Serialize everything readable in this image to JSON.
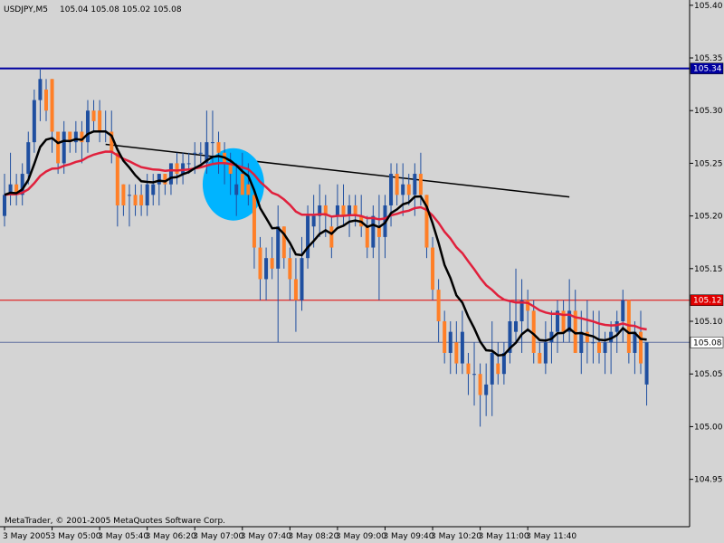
{
  "chart_data": {
    "type": "candlestick",
    "header": {
      "symbol_timeframe": "USDJPY,M5",
      "ohlc": "105.04 105.08 105.02 105.08"
    },
    "copyright": "MetaTrader, © 2001-2005 MetaQuotes Software Corp.",
    "y_axis": {
      "range": [
        104.905,
        105.405
      ],
      "ticks": [
        105.4,
        105.35,
        105.3,
        105.25,
        105.2,
        105.15,
        105.1,
        105.05,
        105.0,
        104.95
      ],
      "tick_labels": [
        "105.40",
        "105.35",
        "105.30",
        "105.25",
        "105.20",
        "105.15",
        "105.10",
        "105.05",
        "105.00",
        "104.95"
      ]
    },
    "x_axis": {
      "ticks": [
        {
          "bar": 0,
          "label": "3 May 2005"
        },
        {
          "bar": 8,
          "label": "3 May 05:00"
        },
        {
          "bar": 16,
          "label": "3 May 05:40"
        },
        {
          "bar": 24,
          "label": "3 May 06:20"
        },
        {
          "bar": 32,
          "label": "3 May 07:00"
        },
        {
          "bar": 40,
          "label": "3 May 07:40"
        },
        {
          "bar": 48,
          "label": "3 May 08:20"
        },
        {
          "bar": 56,
          "label": "3 May 09:00"
        },
        {
          "bar": 64,
          "label": "3 May 09:40"
        },
        {
          "bar": 72,
          "label": "3 May 10:20"
        },
        {
          "bar": 80,
          "label": "3 May 11:00"
        },
        {
          "bar": 88,
          "label": "3 May 11:40"
        }
      ]
    },
    "horizontal_lines": [
      {
        "price": 105.34,
        "label": "105.34",
        "color": "#0000a0",
        "width": 2,
        "label_bg": "#0000a0",
        "label_fg": "#ffffff"
      },
      {
        "price": 105.12,
        "label": "105.12",
        "color": "#e00000",
        "width": 1,
        "label_bg": "#e00000",
        "label_fg": "#ffffff"
      },
      {
        "price": 105.08,
        "label": "105.08",
        "color": "#6070a0",
        "width": 1,
        "label_bg": "#ffffff",
        "label_fg": "#000000"
      }
    ],
    "trendline": {
      "from": {
        "bar": 17,
        "price": 105.268
      },
      "to": {
        "bar": 95,
        "price": 105.218
      },
      "color": "#000000"
    },
    "highlight_circle": {
      "bar": 38.5,
      "price": 105.23,
      "color": "#00b4ff"
    },
    "bull_color": "#1f4fa0",
    "bear_color": "#ff7f27",
    "ma_fast_color": "#000000",
    "ma_slow_color": "#e0203c",
    "candles": [
      [
        105.2,
        105.24,
        105.19,
        105.22
      ],
      [
        105.22,
        105.26,
        105.21,
        105.23
      ],
      [
        105.23,
        105.24,
        105.21,
        105.22
      ],
      [
        105.22,
        105.25,
        105.21,
        105.24
      ],
      [
        105.24,
        105.28,
        105.23,
        105.27
      ],
      [
        105.27,
        105.32,
        105.26,
        105.31
      ],
      [
        105.31,
        105.34,
        105.29,
        105.33
      ],
      [
        105.32,
        105.33,
        105.29,
        105.3
      ],
      [
        105.33,
        105.33,
        105.26,
        105.28
      ],
      [
        105.28,
        105.28,
        105.24,
        105.25
      ],
      [
        105.25,
        105.29,
        105.24,
        105.28
      ],
      [
        105.28,
        105.28,
        105.26,
        105.27
      ],
      [
        105.27,
        105.29,
        105.26,
        105.28
      ],
      [
        105.28,
        105.29,
        105.25,
        105.27
      ],
      [
        105.27,
        105.31,
        105.26,
        105.3
      ],
      [
        105.3,
        105.31,
        105.28,
        105.29
      ],
      [
        105.3,
        105.31,
        105.27,
        105.28
      ],
      [
        105.28,
        105.3,
        105.27,
        105.28
      ],
      [
        105.28,
        105.3,
        105.25,
        105.26
      ],
      [
        105.26,
        105.26,
        105.19,
        105.21
      ],
      [
        105.23,
        105.23,
        105.2,
        105.21
      ],
      [
        105.22,
        105.23,
        105.19,
        105.22
      ],
      [
        105.22,
        105.23,
        105.2,
        105.21
      ],
      [
        105.22,
        105.23,
        105.2,
        105.21
      ],
      [
        105.21,
        105.24,
        105.2,
        105.23
      ],
      [
        105.22,
        105.24,
        105.21,
        105.23
      ],
      [
        105.23,
        105.24,
        105.21,
        105.24
      ],
      [
        105.24,
        105.24,
        105.22,
        105.23
      ],
      [
        105.23,
        105.25,
        105.22,
        105.25
      ],
      [
        105.25,
        105.26,
        105.23,
        105.24
      ],
      [
        105.24,
        105.26,
        105.23,
        105.25
      ],
      [
        105.25,
        105.26,
        105.24,
        105.25
      ],
      [
        105.26,
        105.27,
        105.24,
        105.26
      ],
      [
        105.26,
        105.27,
        105.25,
        105.26
      ],
      [
        105.25,
        105.3,
        105.24,
        105.27
      ],
      [
        105.27,
        105.3,
        105.25,
        105.27
      ],
      [
        105.27,
        105.28,
        105.24,
        105.26
      ],
      [
        105.26,
        105.27,
        105.23,
        105.25
      ],
      [
        105.25,
        105.26,
        105.22,
        105.24
      ],
      [
        105.22,
        105.25,
        105.2,
        105.23
      ],
      [
        105.24,
        105.26,
        105.22,
        105.22
      ],
      [
        105.23,
        105.25,
        105.21,
        105.22
      ],
      [
        105.22,
        105.22,
        105.15,
        105.17
      ],
      [
        105.17,
        105.18,
        105.12,
        105.14
      ],
      [
        105.14,
        105.17,
        105.12,
        105.16
      ],
      [
        105.16,
        105.18,
        105.14,
        105.15
      ],
      [
        105.15,
        105.21,
        105.08,
        105.19
      ],
      [
        105.19,
        105.19,
        105.15,
        105.16
      ],
      [
        105.16,
        105.17,
        105.12,
        105.14
      ],
      [
        105.14,
        105.16,
        105.09,
        105.12
      ],
      [
        105.12,
        105.18,
        105.11,
        105.16
      ],
      [
        105.16,
        105.21,
        105.15,
        105.2
      ],
      [
        105.19,
        105.22,
        105.17,
        105.2
      ],
      [
        105.2,
        105.23,
        105.18,
        105.21
      ],
      [
        105.21,
        105.22,
        105.18,
        105.2
      ],
      [
        105.19,
        105.2,
        105.16,
        105.17
      ],
      [
        105.2,
        105.23,
        105.19,
        105.21
      ],
      [
        105.21,
        105.23,
        105.19,
        105.2
      ],
      [
        105.2,
        105.22,
        105.18,
        105.21
      ],
      [
        105.21,
        105.22,
        105.19,
        105.2
      ],
      [
        105.2,
        105.22,
        105.18,
        105.19
      ],
      [
        105.19,
        105.2,
        105.16,
        105.17
      ],
      [
        105.17,
        105.21,
        105.16,
        105.2
      ],
      [
        105.19,
        105.22,
        105.12,
        105.18
      ],
      [
        105.18,
        105.22,
        105.16,
        105.21
      ],
      [
        105.21,
        105.25,
        105.19,
        105.24
      ],
      [
        105.24,
        105.25,
        105.21,
        105.22
      ],
      [
        105.22,
        105.25,
        105.2,
        105.23
      ],
      [
        105.23,
        105.24,
        105.21,
        105.22
      ],
      [
        105.22,
        105.25,
        105.2,
        105.24
      ],
      [
        105.24,
        105.26,
        105.21,
        105.22
      ],
      [
        105.22,
        105.22,
        105.16,
        105.17
      ],
      [
        105.17,
        105.18,
        105.12,
        105.13
      ],
      [
        105.13,
        105.14,
        105.08,
        105.1
      ],
      [
        105.1,
        105.11,
        105.06,
        105.07
      ],
      [
        105.07,
        105.1,
        105.05,
        105.09
      ],
      [
        105.08,
        105.1,
        105.05,
        105.06
      ],
      [
        105.06,
        105.11,
        105.05,
        105.09
      ],
      [
        105.06,
        105.07,
        105.03,
        105.05
      ],
      [
        105.05,
        105.08,
        105.02,
        105.05
      ],
      [
        105.05,
        105.06,
        105.0,
        105.03
      ],
      [
        105.03,
        105.06,
        105.01,
        105.04
      ],
      [
        105.04,
        105.1,
        105.01,
        105.07
      ],
      [
        105.06,
        105.08,
        105.04,
        105.05
      ],
      [
        105.05,
        105.08,
        105.04,
        105.07
      ],
      [
        105.07,
        105.12,
        105.06,
        105.1
      ],
      [
        105.09,
        105.15,
        105.08,
        105.1
      ],
      [
        105.1,
        105.14,
        105.07,
        105.12
      ],
      [
        105.12,
        105.13,
        105.09,
        105.11
      ],
      [
        105.11,
        105.12,
        105.06,
        105.07
      ],
      [
        105.07,
        105.08,
        105.06,
        105.06
      ],
      [
        105.06,
        105.1,
        105.05,
        105.08
      ],
      [
        105.08,
        105.11,
        105.06,
        105.09
      ],
      [
        105.09,
        105.12,
        105.07,
        105.11
      ],
      [
        105.11,
        105.12,
        105.08,
        105.09
      ],
      [
        105.09,
        105.14,
        105.08,
        105.11
      ],
      [
        105.11,
        105.13,
        105.07,
        105.07
      ],
      [
        105.07,
        105.11,
        105.05,
        105.09
      ],
      [
        105.09,
        105.12,
        105.06,
        105.08
      ],
      [
        105.08,
        105.11,
        105.06,
        105.08
      ],
      [
        105.08,
        105.11,
        105.06,
        105.07
      ],
      [
        105.07,
        105.09,
        105.05,
        105.08
      ],
      [
        105.08,
        105.1,
        105.05,
        105.09
      ],
      [
        105.09,
        105.11,
        105.07,
        105.1
      ],
      [
        105.1,
        105.13,
        105.08,
        105.12
      ],
      [
        105.12,
        105.12,
        105.06,
        105.07
      ],
      [
        105.07,
        105.1,
        105.05,
        105.09
      ],
      [
        105.09,
        105.11,
        105.05,
        105.06
      ],
      [
        105.04,
        105.08,
        105.02,
        105.08
      ]
    ]
  }
}
